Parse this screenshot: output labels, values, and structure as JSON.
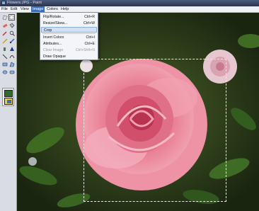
{
  "window": {
    "title": "Flowers.JPG - Paint"
  },
  "menubar": {
    "items": [
      "File",
      "Edit",
      "View",
      "Image",
      "Colors",
      "Help"
    ]
  },
  "image_menu": {
    "items": [
      {
        "label": "Flip/Rotate...",
        "shortcut": "Ctrl+R",
        "state": "normal"
      },
      {
        "label": "Resize/Skew...",
        "shortcut": "Ctrl+W",
        "state": "normal"
      },
      {
        "label": "Crop",
        "shortcut": "",
        "state": "highlighted"
      },
      {
        "label": "Invert Colors",
        "shortcut": "Ctrl+I",
        "state": "normal"
      },
      {
        "label": "Attributes...",
        "shortcut": "Ctrl+E",
        "state": "normal"
      },
      {
        "label": "Clear Image",
        "shortcut": "Ctrl+Shft+N",
        "state": "disabled"
      },
      {
        "label": "Draw Opaque",
        "shortcut": "",
        "state": "normal"
      }
    ]
  },
  "toolbox": {
    "tools": [
      "free-select-icon",
      "select-icon",
      "eraser-icon",
      "fill-icon",
      "color-picker-icon",
      "magnifier-icon",
      "pencil-icon",
      "brush-icon",
      "airbrush-icon",
      "text-icon",
      "line-icon",
      "curve-icon",
      "rectangle-icon",
      "polygon-icon",
      "ellipse-icon",
      "rounded-rect-icon"
    ],
    "selected_tool": "select-icon"
  },
  "colors": {
    "menu_highlight": "#cfe0f7",
    "title_bar": "#2a3450",
    "rose": "#e27a8e"
  }
}
